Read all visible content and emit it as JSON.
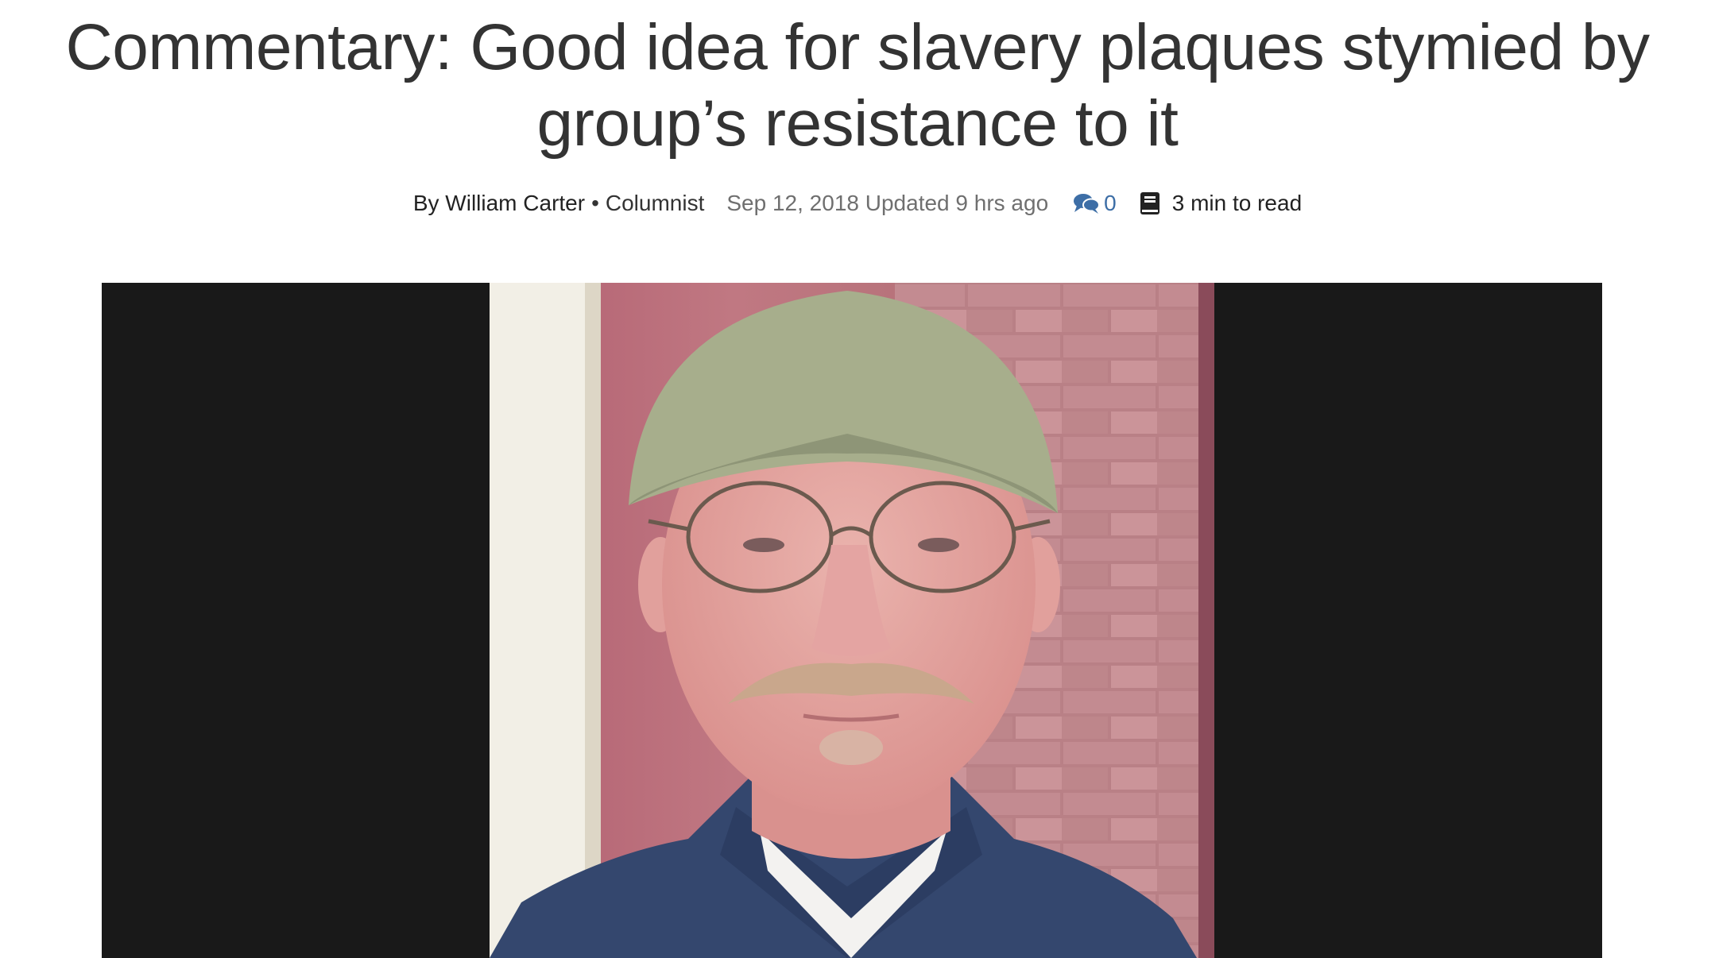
{
  "article": {
    "headline": "Commentary: Good idea for slavery plaques stymied by group’s resistance to it",
    "byline": {
      "author": "By William Carter",
      "separator": "•",
      "role": "Columnist",
      "date": "Sep 12, 2018",
      "updated": "Updated 9 hrs ago",
      "comment_count": "0",
      "read_time": "3 min to read"
    },
    "image": {
      "background_color": "#191919"
    }
  },
  "colors": {
    "headline": "#333333",
    "date": "#6f6f6f",
    "comments_accent": "#3d6ea6"
  },
  "icons": {
    "comments": "comments-icon",
    "read_time": "book-icon"
  }
}
